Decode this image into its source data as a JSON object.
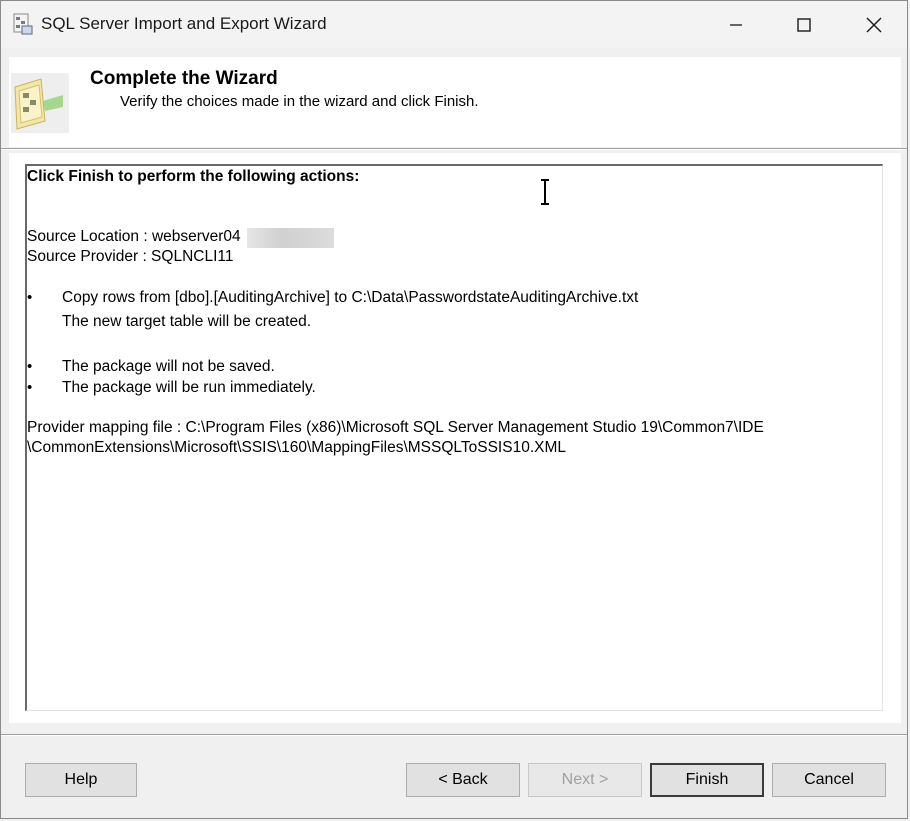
{
  "window": {
    "title": "SQL Server Import and Export Wizard"
  },
  "header": {
    "title": "Complete the Wizard",
    "subtitle": "Verify the choices made in the wizard and click Finish."
  },
  "report": {
    "heading": "Click Finish to perform the following actions:",
    "source_location": "Source Location : webserver04",
    "source_provider": "Source Provider : SQLNCLI11",
    "bullets": [
      {
        "symbol": "•",
        "text": "Copy rows from [dbo].[AuditingArchive] to C:\\Data\\PasswordstateAuditingArchive.txt",
        "detail": "The new target table will be created."
      },
      {
        "symbol": "•",
        "text": "The package will not be saved."
      },
      {
        "symbol": "•",
        "text": "The package will be run immediately."
      }
    ],
    "mapping_line1": "Provider mapping file : C:\\Program Files (x86)\\Microsoft SQL Server Management Studio 19\\Common7\\IDE",
    "mapping_line2": "\\CommonExtensions\\Microsoft\\SSIS\\160\\MappingFiles\\MSSQLToSSIS10.XML"
  },
  "buttons": {
    "help": "Help",
    "back": "< Back",
    "next": "Next >",
    "finish": "Finish",
    "cancel": "Cancel"
  }
}
